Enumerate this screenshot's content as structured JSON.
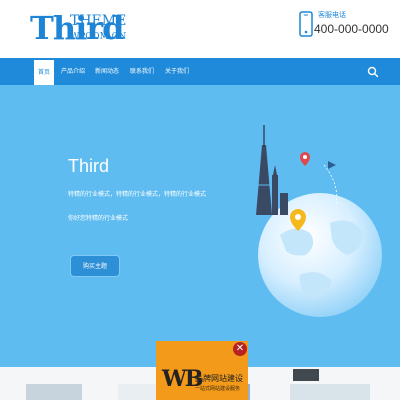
{
  "logo": {
    "big": "Third",
    "theme": "THEME",
    "url": "WPCOM.CN"
  },
  "contact": {
    "label": "客服电话",
    "number": "400-000-0000",
    "icon": "phone-icon"
  },
  "nav": {
    "items": [
      {
        "label": "首页",
        "active": true
      },
      {
        "label": "产品介绍",
        "active": false
      },
      {
        "label": "新闻动态",
        "active": false
      },
      {
        "label": "联系我们",
        "active": false
      },
      {
        "label": "关于我们",
        "active": false
      }
    ],
    "search_icon": "search-icon"
  },
  "banner": {
    "title": "Third",
    "line1": "特精的行业模式，特精的行业模式，特精的行业模式",
    "line2": "你好您特精的行业模式",
    "button": "购买主题"
  },
  "ad": {
    "logo": "WB",
    "title": "品牌网站建设",
    "subtitle": "一站式网站建设服务",
    "close": "✕"
  },
  "colors": {
    "brand": "#1f8ad9",
    "banner_bg": "#5ebcf0",
    "ad_bg": "#f39a1b"
  }
}
